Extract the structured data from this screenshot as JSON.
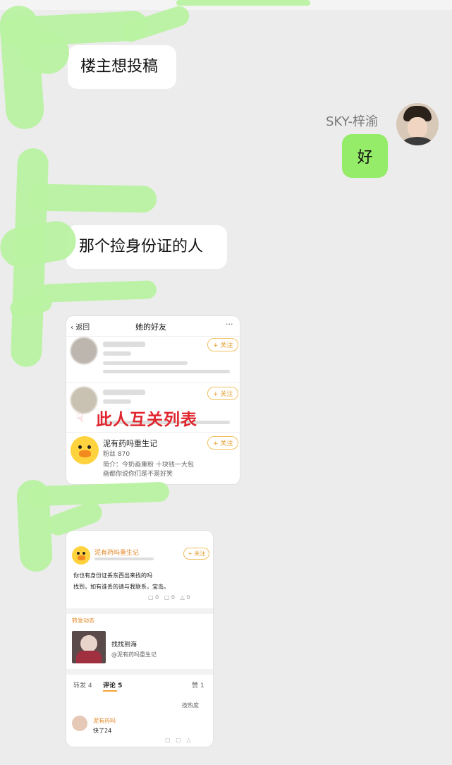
{
  "chat": {
    "msg1": "楼主想投稿",
    "sender_name": "SKY-梓渝",
    "msg2": "好",
    "msg3": "那个捡身份证的人"
  },
  "screenshot1": {
    "back_label": "返回",
    "title": "她的好友",
    "more_label": "···",
    "follow_label": "+ 关注",
    "overlay_text": "此人互关列表",
    "user3_name": "泥有药吗重生记",
    "user3_fans": "粉丝 870",
    "user3_line1": "简介：今奶画重粉 十块钱一大包",
    "user3_line2": "画都你说你们是不是好笑"
  },
  "screenshot2": {
    "post_author": "泥有药吗重生记",
    "follow_label": "+ 关注",
    "post_line1": "你也有身份证丢东西出来找的吗",
    "post_line2": "找到，如有谁丢的请与我联系，宝岛。",
    "quote_header": "转发动态",
    "quote_name": "找找到海",
    "quote_sub": "@泥有药吗重生记",
    "tab_forward": "转发 4",
    "tab_comment": "评论 5",
    "tab_like": "赞 1",
    "sort_label": "按热度",
    "comment_user": "泥有药吗",
    "comment_text": "快了24"
  },
  "colors": {
    "background": "#ececec",
    "my_bubble": "#95ec69",
    "other_bubble": "#ffffff",
    "overlay_text": "#e0252e",
    "scribble": "#b9f2a1"
  }
}
